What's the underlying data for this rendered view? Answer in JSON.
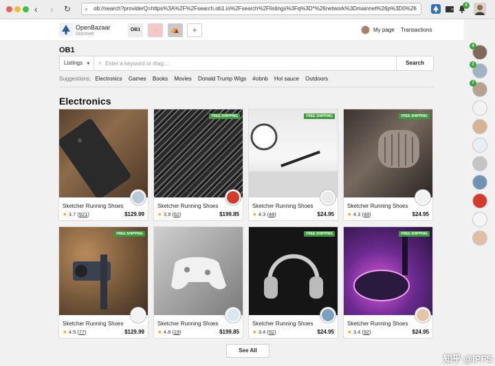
{
  "browser": {
    "url": "ob://search?providerQ=https%3A%2F%2Fsearch.ob1.io%2Fsearch%2Flistings%3Fq%3D*%26network%3Dmainnet%26p%3D0%26",
    "notification_count": "3"
  },
  "header": {
    "brand": "OpenBazaar",
    "subtitle": "Discover",
    "tab_active": "OB1",
    "my_page": "My page",
    "transactions": "Transactions"
  },
  "provider_title": "OB1",
  "search": {
    "type_label": "Listings",
    "placeholder": "Enter a keyword or #tag...",
    "button": "Search"
  },
  "suggestions": {
    "label": "Suggestions:",
    "items": [
      "Electronics",
      "Games",
      "Books",
      "Movies",
      "Donald Trump Wigs",
      "#obnb",
      "Hot sauce",
      "Outdoors"
    ]
  },
  "section_title": "Electronics",
  "cards": [
    {
      "title": "Sketcher Running Shoes",
      "rating": "3.7",
      "count": "921",
      "price": "$129.99",
      "free_shipping": false,
      "photo": "phone-on-fur"
    },
    {
      "title": "Sketcher Running Shoes",
      "rating": "3.9",
      "count": "62",
      "price": "$199.85",
      "free_shipping": true,
      "photo": "mixing-console"
    },
    {
      "title": "Sketcher Running Shoes",
      "rating": "4.3",
      "count": "48",
      "price": "$24.95",
      "free_shipping": true,
      "photo": "desk-clock"
    },
    {
      "title": "Sketcher Running Shoes",
      "rating": "4.3",
      "count": "48",
      "price": "$24.95",
      "free_shipping": true,
      "photo": "microphone"
    },
    {
      "title": "Sketcher Running Shoes",
      "rating": "4.5",
      "count": "77",
      "price": "$129.99",
      "free_shipping": true,
      "photo": "camera-gimbal"
    },
    {
      "title": "Sketcher Running Shoes",
      "rating": "4.8",
      "count": "19",
      "price": "$199.85",
      "free_shipping": false,
      "photo": "game-controller"
    },
    {
      "title": "Sketcher Running Shoes",
      "rating": "3.4",
      "count": "92",
      "price": "$24.95",
      "free_shipping": true,
      "photo": "headphones"
    },
    {
      "title": "Sketcher Running Shoes",
      "rating": "3.4",
      "count": "92",
      "price": "$24.95",
      "free_shipping": true,
      "photo": "dj-deck"
    }
  ],
  "free_shipping_label": "FREE SHIPPING",
  "see_all": "See All",
  "sidebar_badges": [
    "4",
    "2",
    "7"
  ],
  "watermark": "知乎 @IPFS"
}
